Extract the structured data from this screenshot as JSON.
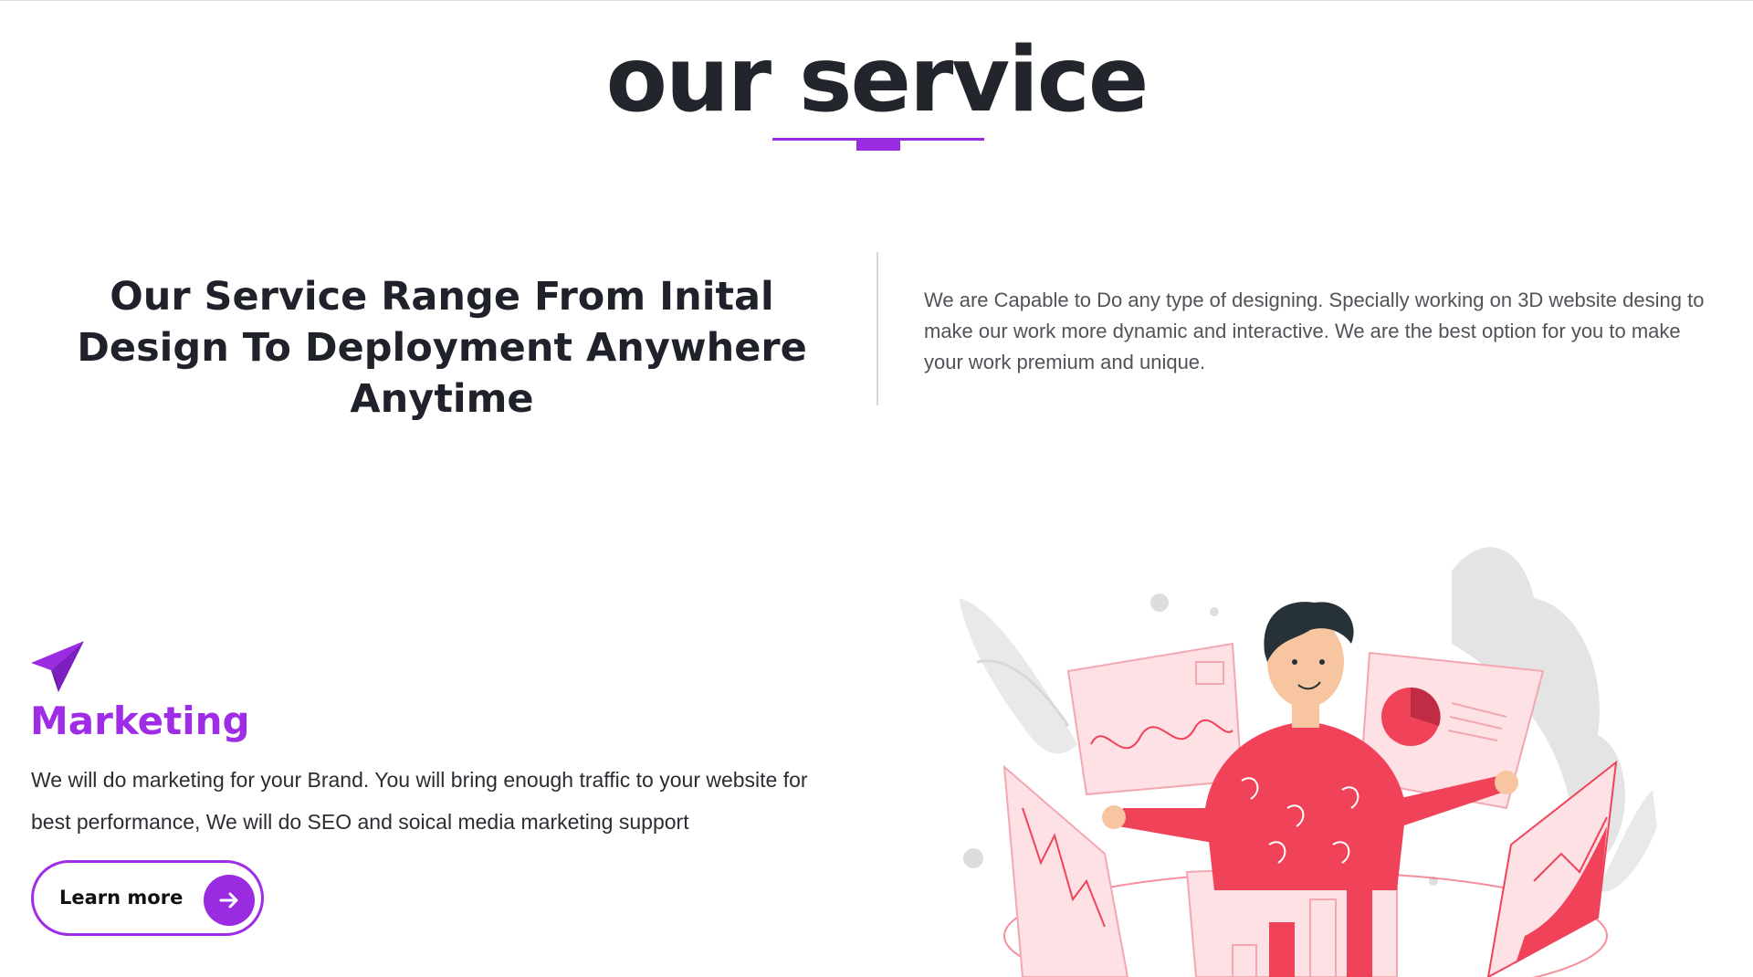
{
  "section": {
    "title": "our service"
  },
  "intro": {
    "headline": "Our Service Range From Inital Design To Deployment Anywhere Anytime",
    "paragraph": "We are Capable to Do any type of designing. Specially working on 3D website desing to make our work more dynamic and interactive. We are the best option for you to make your work premium and unique."
  },
  "service": {
    "icon": "paper-plane-icon",
    "title": "Marketing",
    "description": "We will do marketing for your Brand. You will bring enough traffic to your website for best performance, We will do SEO and soical media marketing support",
    "cta_label": "Learn more",
    "cta_icon": "arrow-right-icon"
  },
  "colors": {
    "accent": "#9b2be0",
    "heading": "#22252c",
    "illustration_red": "#f0435a",
    "illustration_pink": "#fde1e4"
  }
}
